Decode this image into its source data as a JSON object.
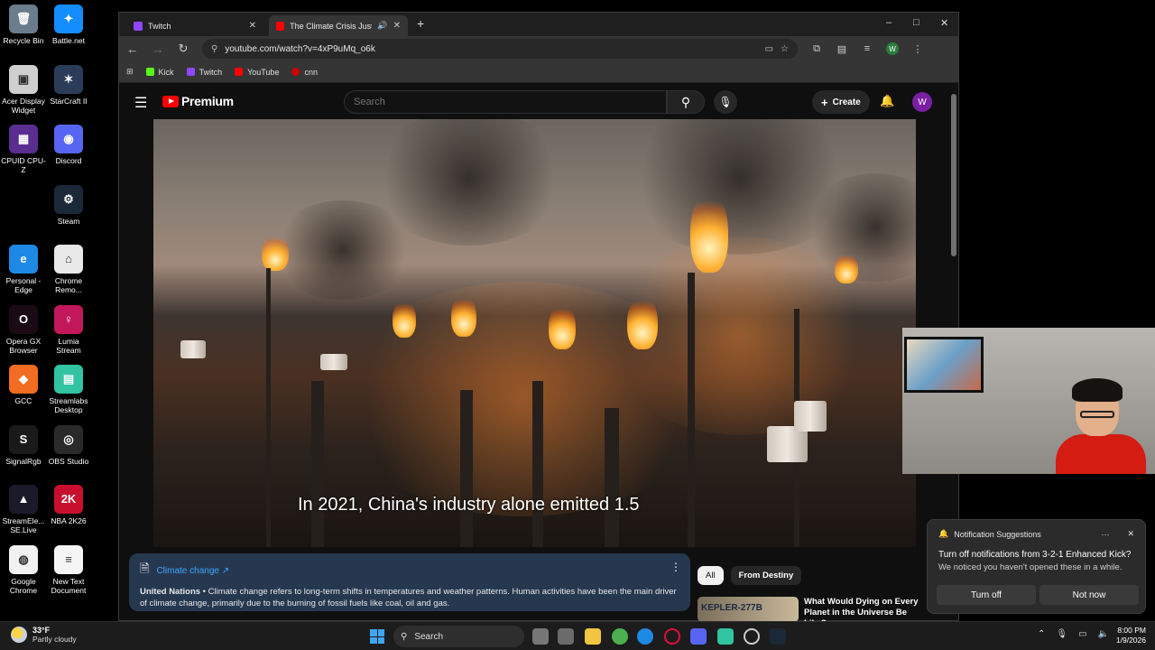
{
  "desktop": {
    "icons": [
      {
        "label": "Recycle Bin",
        "color": "#6b7d8c",
        "glyph": "🗑"
      },
      {
        "label": "Battle.net",
        "color": "#148eff",
        "glyph": "✦"
      },
      {
        "label": "Acer Display Widget",
        "color": "#cfcfcf",
        "glyph": "▣"
      },
      {
        "label": "StarCraft II",
        "color": "#2a3c58",
        "glyph": "✶"
      },
      {
        "label": "CPUID CPU-Z",
        "color": "#5a2d91",
        "glyph": "▦"
      },
      {
        "label": "Discord",
        "color": "#5865f2",
        "glyph": "◉"
      },
      {
        "label": "Steam",
        "color": "#1b2838",
        "glyph": "⚙"
      },
      {
        "label": "Personal - Edge",
        "color": "#1e88e5",
        "glyph": "e"
      },
      {
        "label": "Chrome Remo...",
        "color": "#e8e8e8",
        "glyph": "⌂"
      },
      {
        "label": "Opera GX Browser",
        "color": "#1a0a14",
        "glyph": "O"
      },
      {
        "label": "Lumia Stream",
        "color": "#c2185b",
        "glyph": "♀"
      },
      {
        "label": "GCC",
        "color": "#f26c22",
        "glyph": "◆"
      },
      {
        "label": "Streamlabs Desktop",
        "color": "#31c3a2",
        "glyph": "▤"
      },
      {
        "label": "SignalRgb",
        "color": "#1a1a1a",
        "glyph": "S"
      },
      {
        "label": "OBS Studio",
        "color": "#2a2a2a",
        "glyph": "◎"
      },
      {
        "label": "StreamEle... SE.Live",
        "color": "#1a1a2a",
        "glyph": "▲"
      },
      {
        "label": "NBA 2K26",
        "color": "#c8102e",
        "glyph": "2K"
      },
      {
        "label": "Google Chrome",
        "color": "#f2f2f2",
        "glyph": "◍"
      },
      {
        "label": "New Text Document",
        "color": "#f5f5f5",
        "glyph": "≡"
      }
    ]
  },
  "browser": {
    "tabs": [
      {
        "label": "Twitch",
        "fav_color": "#9146ff"
      },
      {
        "label": "The Climate Crisis Just Hit a",
        "fav_color": "#ff0000",
        "audio_icon": "speaker-icon"
      }
    ],
    "new_tab": "+",
    "window_controls": {
      "minimize": "–",
      "maximize": "□",
      "close": "✕"
    },
    "nav": {
      "back": "←",
      "forward": "→",
      "reload": "↻"
    },
    "url": "youtube.com/watch?v=4xP9uMq_o6k",
    "profile_initial": "W",
    "bookmarks": [
      {
        "label": "Kick",
        "color": "#53fc18"
      },
      {
        "label": "Twitch",
        "color": "#9146ff"
      },
      {
        "label": "YouTube",
        "color": "#ff0000"
      },
      {
        "label": "cnn",
        "color": "#cc0000"
      }
    ]
  },
  "youtube": {
    "logo_text": "Premium",
    "search_placeholder": "Search",
    "create_label": "Create",
    "avatar_initial": "W",
    "caption": "In 2021, China's industry alone emitted 1.5",
    "info_panel": {
      "topic_link": "Climate change",
      "source": "United Nations",
      "text": " • Climate change refers to long-term shifts in temperatures and weather patterns. Human activities have been the main driver of climate change, primarily due to the burning of fossil fuels like coal, oil and gas."
    },
    "chips": [
      "All",
      "From Destiny"
    ],
    "recommendation": {
      "thumb_text": "KEPLER-277B",
      "title": "What Would Dying on Every Planet in the Universe Be Like?"
    }
  },
  "notification": {
    "header": "Notification Suggestions",
    "title": "Turn off notifications from 3-2-1 Enhanced Kick?",
    "body": "We noticed you haven't opened these in a while.",
    "btn_turn_off": "Turn off",
    "btn_not_now": "Not now"
  },
  "taskbar": {
    "weather_temp": "33°F",
    "weather_desc": "Partly cloudy",
    "search_label": "Search",
    "time": "8:00 PM",
    "date": "1/9/2026"
  },
  "colors": {
    "youtube_red": "#ff0000",
    "link_blue": "#3ea6ff",
    "panel_blue": "#263850",
    "accent_purple": "#7b1fa2"
  }
}
